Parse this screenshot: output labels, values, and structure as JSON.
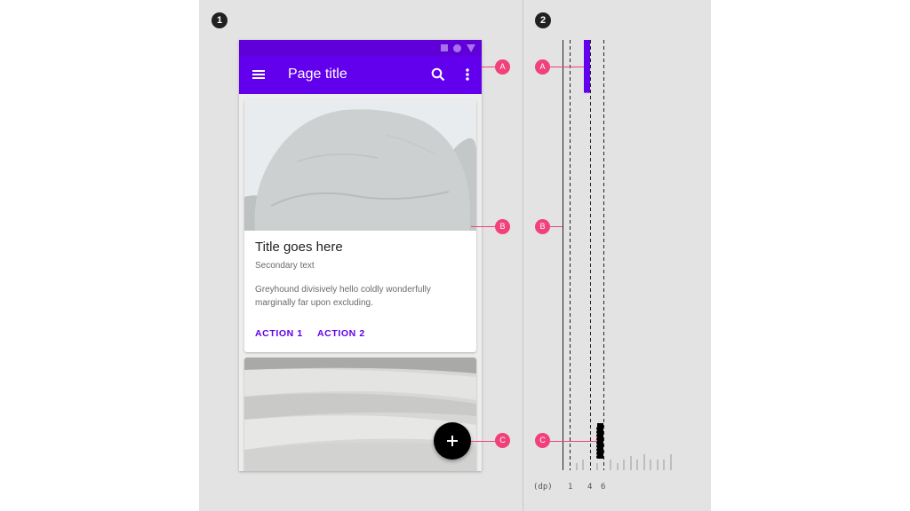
{
  "figure_numbers": [
    "1",
    "2"
  ],
  "phone": {
    "page_title": "Page title",
    "card": {
      "title": "Title goes here",
      "secondary": "Secondary text",
      "body_line1": "Greyhound divisively hello coldly wonderfully",
      "body_line2": "marginally far upon excluding.",
      "action1": "ACTION 1",
      "action2": "ACTION 2"
    }
  },
  "callouts": [
    "A",
    "B",
    "C"
  ],
  "elevation_scale": {
    "unit": "(dp)",
    "ticks": [
      "1",
      "4",
      "6"
    ]
  },
  "colors": {
    "primary": "#6200ee",
    "status_bar": "#5f00d9",
    "callout": "#f0417a",
    "fab": "#000000",
    "background": "#e3e3e3"
  },
  "icons": [
    "menu-icon",
    "search-icon",
    "more-vert-icon",
    "add-icon"
  ]
}
